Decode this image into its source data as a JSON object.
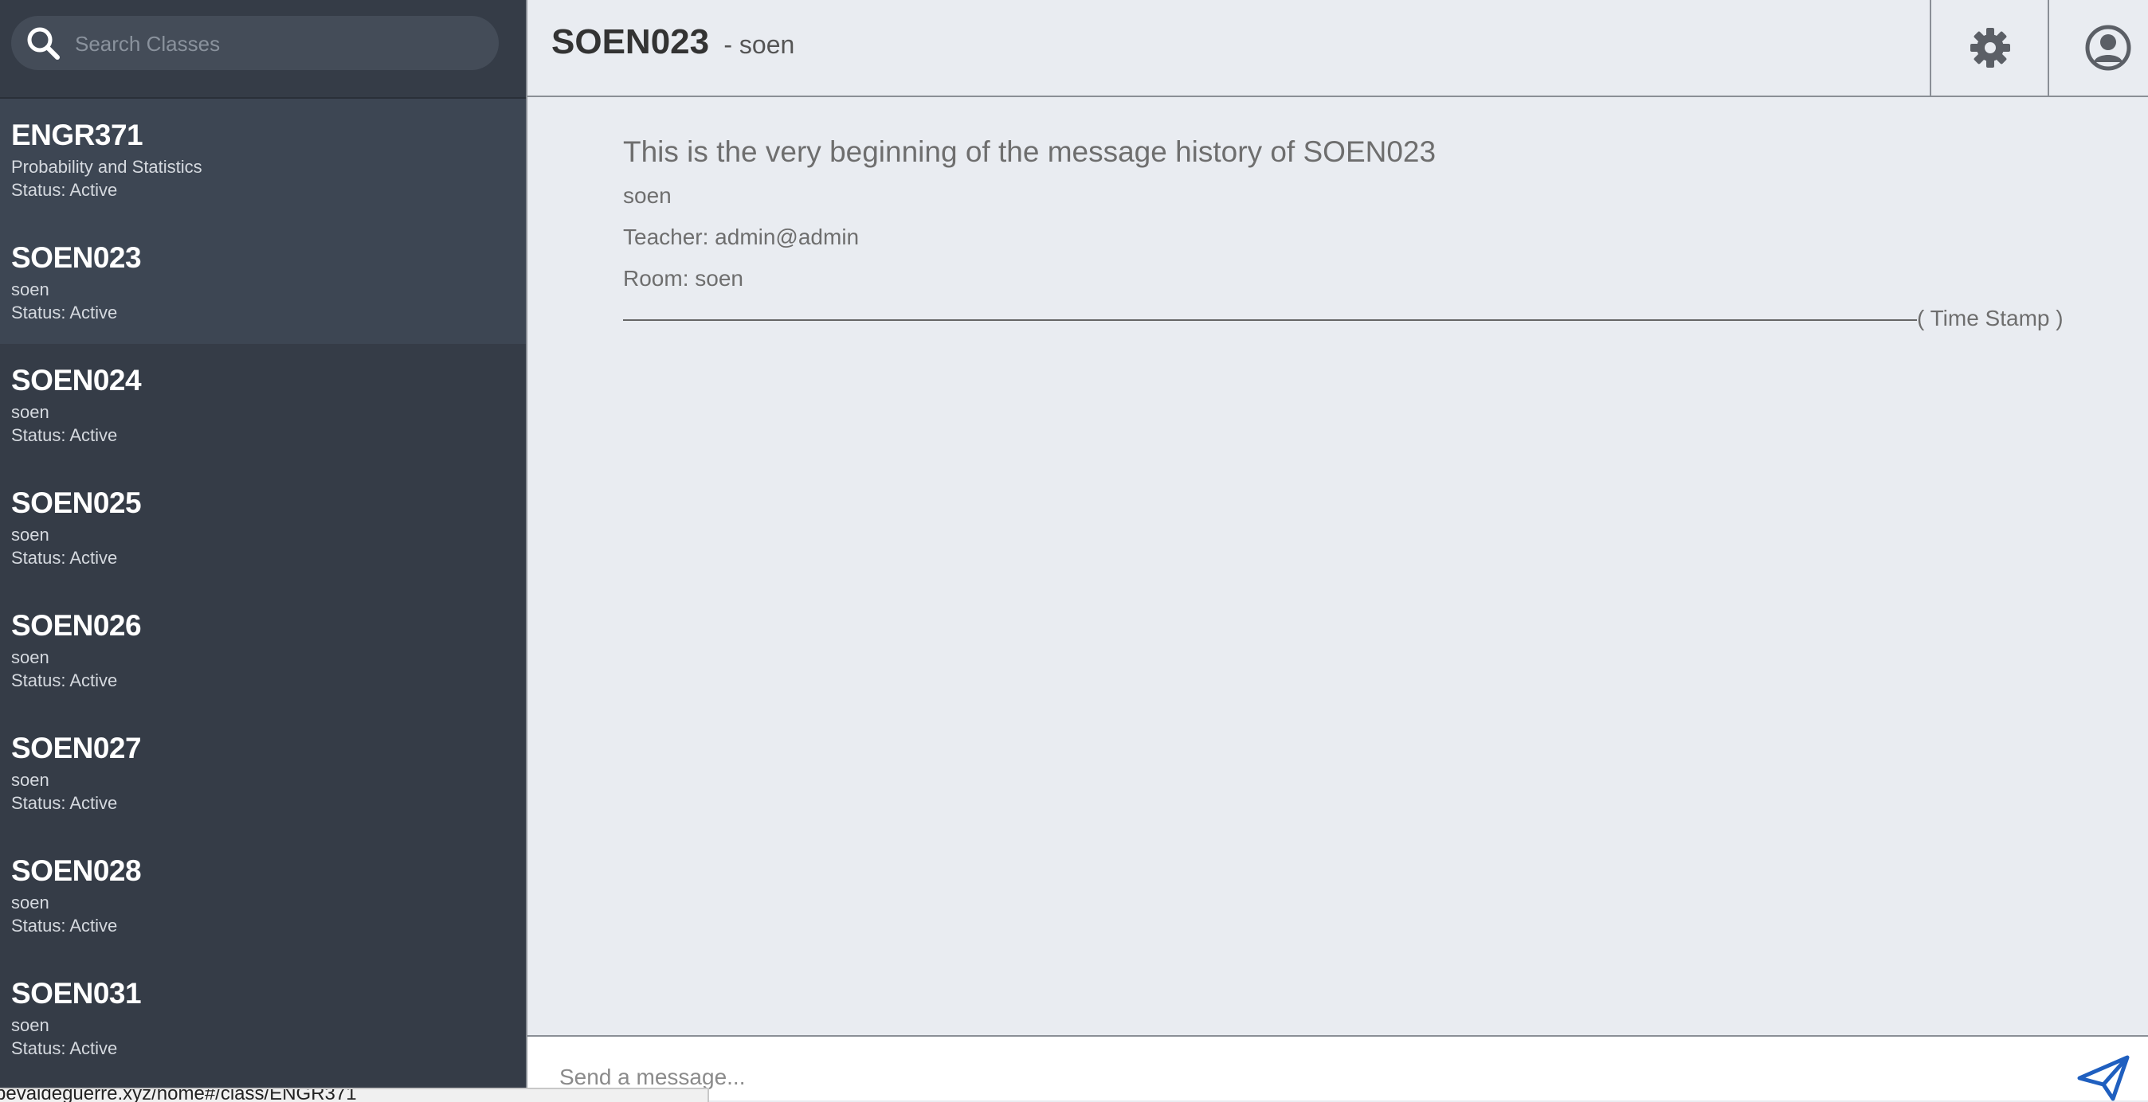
{
  "search": {
    "placeholder": "Search Classes"
  },
  "classes": [
    {
      "code": "ENGR371",
      "name": "Probability and Statistics",
      "status": "Status: Active"
    },
    {
      "code": "SOEN023",
      "name": "soen",
      "status": "Status: Active"
    },
    {
      "code": "SOEN024",
      "name": "soen",
      "status": "Status: Active"
    },
    {
      "code": "SOEN025",
      "name": "soen",
      "status": "Status: Active"
    },
    {
      "code": "SOEN026",
      "name": "soen",
      "status": "Status: Active"
    },
    {
      "code": "SOEN027",
      "name": "soen",
      "status": "Status: Active"
    },
    {
      "code": "SOEN028",
      "name": "soen",
      "status": "Status: Active"
    },
    {
      "code": "SOEN031",
      "name": "soen",
      "status": "Status: Active"
    }
  ],
  "header": {
    "title": "SOEN023",
    "subtitle": "- soen"
  },
  "icons": {
    "settings": "gear-icon",
    "profile": "user-circle-icon",
    "search": "search-icon",
    "send": "paper-plane-icon"
  },
  "intro": {
    "title": "This is the very beginning of the message history of SOEN023",
    "name": "soen",
    "teacher": "Teacher: admin@admin",
    "room": "Room: soen"
  },
  "timestamp_label": "( Time Stamp )",
  "composer": {
    "placeholder": "Send a message..."
  },
  "status_url": "bevaldeguerre.xyz/home#/class/ENGR371",
  "colors": {
    "sidebar": "#353c47",
    "sidebar_highlight": "#3d4653",
    "main_bg": "#e9ecf1",
    "send_blue": "#1f5fbf"
  }
}
